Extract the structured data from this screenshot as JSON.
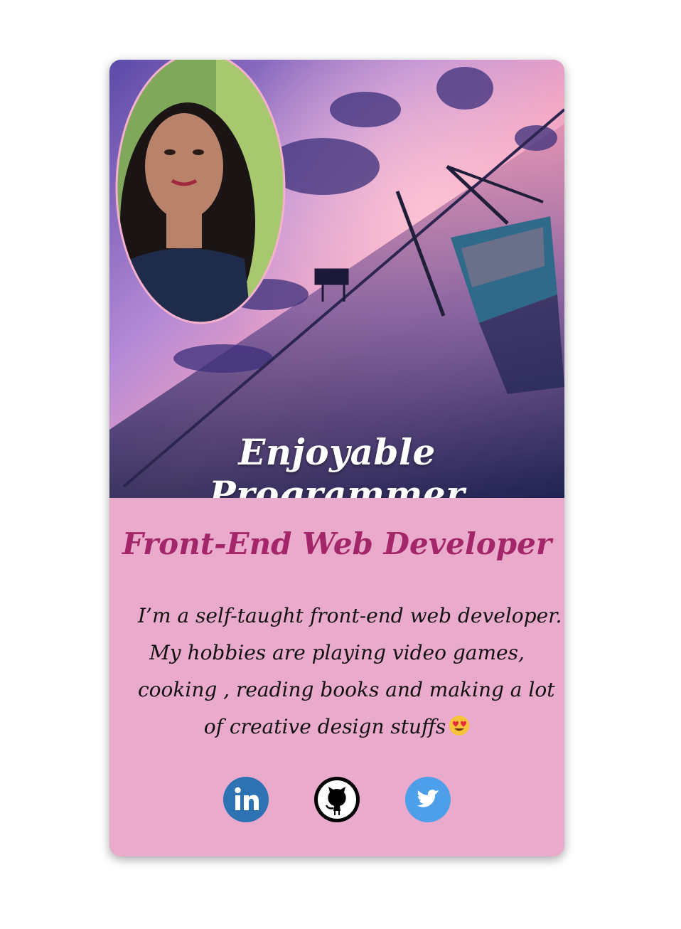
{
  "hero": {
    "title": "Enjoyable Programmer",
    "photo_alt": "profile-photo"
  },
  "profile": {
    "role": "Front-End Web Developer",
    "bio_lines": [
      "I’m a self-taught front-end web developer.",
      "My hobbies are playing video games,",
      "cooking , reading books and making a lot",
      "of creative design stuffs"
    ]
  },
  "socials": [
    {
      "name": "LinkedIn",
      "icon": "linkedin-icon",
      "color": "#2d73b4"
    },
    {
      "name": "GitHub",
      "icon": "github-icon",
      "color": "#000000"
    },
    {
      "name": "Twitter",
      "icon": "twitter-icon",
      "color": "#4c9fe8"
    }
  ],
  "colors": {
    "card_background": "#eaaacb",
    "role_text": "#a3256a",
    "bio_text": "#111111"
  }
}
